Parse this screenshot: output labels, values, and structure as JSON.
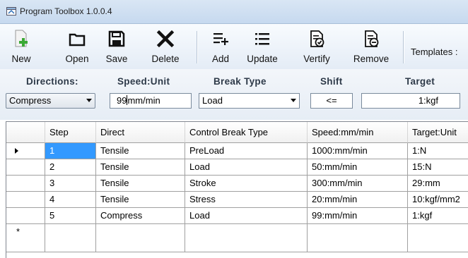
{
  "window": {
    "title": "Program Toolbox 1.0.0.4"
  },
  "toolbar": {
    "new_label": "New",
    "open_label": "Open",
    "save_label": "Save",
    "delete_label": "Delete",
    "add_label": "Add",
    "update_label": "Update",
    "verify_label": "Vertify",
    "remove_label": "Remove",
    "templates_label": "Templates :"
  },
  "params": {
    "directions_label": "Directions:",
    "speed_label": "Speed:Unit",
    "break_type_label": "Break Type",
    "shift_label": "Shift",
    "target_label": "Target",
    "direction_value": "Compress",
    "speed_value_before_caret": "99",
    "speed_value_after_caret": "mm/min",
    "break_type_value": "Load",
    "shift_value": "<=",
    "target_value": "1:kgf"
  },
  "grid": {
    "columns": [
      "Step",
      "Direct",
      "Control Break Type",
      "Speed:mm/min",
      "Target:Unit"
    ],
    "rows": [
      [
        "1",
        "Tensile",
        "PreLoad",
        "1000:mm/min",
        "1:N"
      ],
      [
        "2",
        "Tensile",
        "Load",
        "50:mm/min",
        "15:N"
      ],
      [
        "3",
        "Tensile",
        "Stroke",
        "300:mm/min",
        "29:mm"
      ],
      [
        "4",
        "Tensile",
        "Stress",
        "20:mm/min",
        "10:kgf/mm2"
      ],
      [
        "5",
        "Compress",
        "Load",
        "99:mm/min",
        "1:kgf"
      ]
    ],
    "new_row_marker": "*"
  },
  "colors": {
    "selection": "#3399ff",
    "new_icon_green": "#3aa935"
  }
}
